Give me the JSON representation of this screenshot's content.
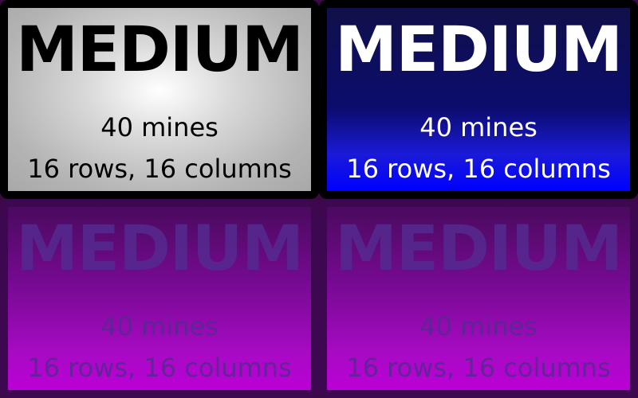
{
  "cards": [
    {
      "title": "MEDIUM",
      "mines": "40 mines",
      "size": "16 rows, 16 columns"
    },
    {
      "title": "MEDIUM",
      "mines": "40 mines",
      "size": "16 rows, 16 columns"
    },
    {
      "title": "MEDIUM",
      "mines": "40 mines",
      "size": "16 rows, 16 columns"
    },
    {
      "title": "MEDIUM",
      "mines": "40 mines",
      "size": "16 rows, 16 columns"
    }
  ],
  "colors": {
    "grey_card_bg": "#b4b4b4",
    "blue_card_bg": "#0c0c6e",
    "purple_card_bg": "#a80ac4",
    "border": "#000000"
  }
}
